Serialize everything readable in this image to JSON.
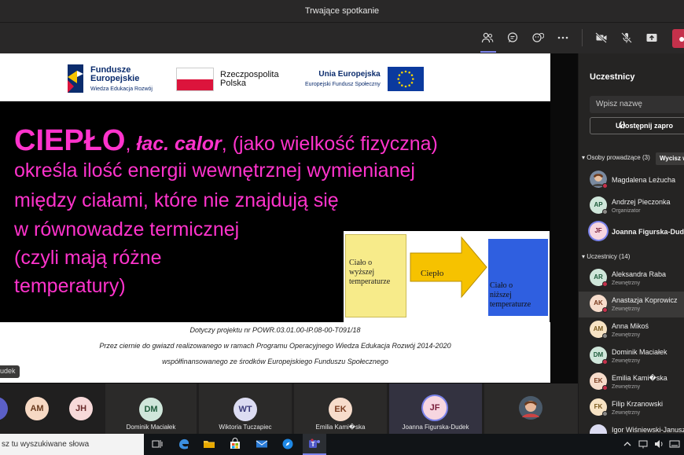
{
  "window": {
    "title": "Trwające spotkanie"
  },
  "colors": {
    "accent": "#7b83eb",
    "leave": "#c4314b",
    "slide_text": "#ff33cc"
  },
  "toolbar": {
    "icons": [
      "participants-icon",
      "chat-icon",
      "reactions-icon",
      "more-icon",
      "camera-off-icon",
      "mic-off-icon",
      "share-icon",
      "leave-icon"
    ]
  },
  "slide": {
    "logos": {
      "fe_line1": "Fundusze",
      "fe_line2": "Europejskie",
      "fe_sub": "Wiedza Edukacja Rozwój",
      "rp_line1": "Rzeczpospolita",
      "rp_line2": "Polska",
      "ue_line1": "Unia Europejska",
      "ue_sub": "Europejski Fundusz Społeczny"
    },
    "heading": {
      "word": "CIEPŁO",
      "comma1": ", ",
      "lac": "łac. calor",
      "comma2": ", ",
      "rest": "(jako wielkość fizyczna)"
    },
    "lines": [
      "określa ilość energii wewnętrznej wymienianej",
      "między ciałami, które nie znajdują się",
      "w równowadze termicznej",
      "(czyli mają różne",
      "temperatury)"
    ],
    "diagram": {
      "left_box": [
        "Ciało o",
        "wyższej",
        "temperaturze"
      ],
      "arrow_label": "Ciepło",
      "right_box": [
        "Ciało o",
        "niższej",
        "temperaturze"
      ]
    },
    "footer": [
      "Dotyczy projektu nr POWR.03.01.00-IP.08-00-T091/18",
      "Przez ciernie do gwiazd realizowanego w ramach Programu Operacyjnego Wiedza Edukacja Rozwój 2014-2020",
      "współfinansowanego ze środków Europejskiego Funduszu Społecznego"
    ]
  },
  "speaker_tag": "udek",
  "gallery": [
    {
      "initials": "AM",
      "name": ""
    },
    {
      "initials": "JH",
      "name": ""
    },
    {
      "initials": "DM",
      "name": "Dominik Maciałek"
    },
    {
      "initials": "WT",
      "name": "Wiktoria Tuczapiec"
    },
    {
      "initials": "EK",
      "name": "Emilia Kami�ska"
    },
    {
      "initials": "JF",
      "name": "Joanna Figurska-Dudek"
    }
  ],
  "panel": {
    "title": "Uczestnicy",
    "search_placeholder": "Wpisz nazwę",
    "share_label": "Udostępnij zapro",
    "presenters_header": "Osoby prowadzące (3)",
    "mute_all": "Wycisz w",
    "attendees_header": "Uczestnicy (14)",
    "presenters": [
      {
        "initials": "",
        "name": "Magdalena Leżucha",
        "role": ""
      },
      {
        "initials": "AP",
        "name": "Andrzej Pieczonka",
        "role": "Organizator"
      },
      {
        "initials": "JF",
        "name": "Joanna Figurska-Dudek",
        "role": ""
      }
    ],
    "attendees": [
      {
        "initials": "AR",
        "name": "Aleksandra Raba",
        "role": "Zewnętrzny"
      },
      {
        "initials": "AK",
        "name": "Anastazja Koprowicz",
        "role": "Zewnętrzny"
      },
      {
        "initials": "AM",
        "name": "Anna Mikoś",
        "role": "Zewnętrzny"
      },
      {
        "initials": "DM",
        "name": "Dominik Maciałek",
        "role": "Zewnętrzny"
      },
      {
        "initials": "EK",
        "name": "Emilia Kami�ska",
        "role": "Zewnętrzny"
      },
      {
        "initials": "FK",
        "name": "Filip Krzanowski",
        "role": "Zewnętrzny"
      },
      {
        "initials": "",
        "name": "Igor Wiśniewski-Janusz",
        "role": ""
      }
    ]
  },
  "taskbar": {
    "search_placeholder": "sz tu wyszukiwane słowa"
  }
}
